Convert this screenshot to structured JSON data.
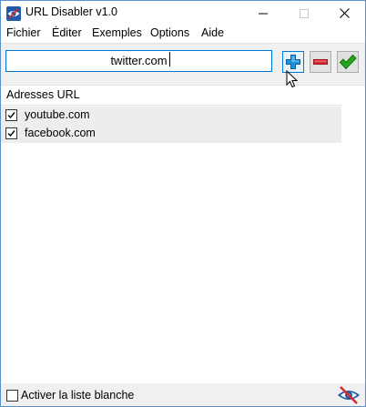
{
  "window": {
    "title": "URL Disabler v1.0",
    "icon": "eye-blocked-icon"
  },
  "menu": {
    "items": [
      {
        "label": "Fichier"
      },
      {
        "label": "Éditer"
      },
      {
        "label": "Exemples"
      },
      {
        "label": "Options"
      },
      {
        "label": "Aide"
      }
    ]
  },
  "toolbar": {
    "url_value": "twitter.com",
    "add_icon": "plus-icon",
    "remove_icon": "minus-icon",
    "apply_icon": "checkmark-icon"
  },
  "list": {
    "header": "Adresses URL",
    "rows": [
      {
        "label": "youtube.com",
        "checked": true
      },
      {
        "label": "facebook.com",
        "checked": true
      }
    ]
  },
  "footer": {
    "whitelist_label": "Activer la liste blanche",
    "whitelist_checked": false
  },
  "colors": {
    "accent": "#0078d7",
    "add": "#1e90d6",
    "remove": "#d9262c",
    "apply": "#22a81a"
  }
}
